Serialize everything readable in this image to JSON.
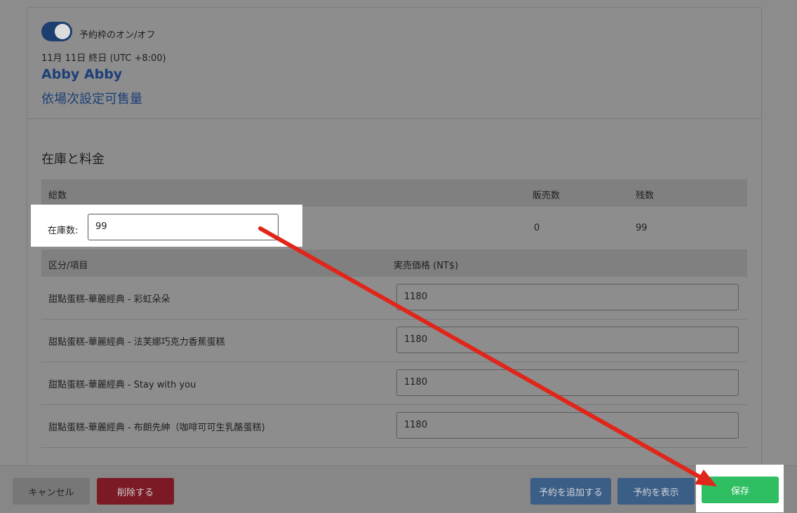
{
  "header": {
    "toggle_label": "予約枠のオン/オフ",
    "date_line": "11月 11日  終日 (UTC +8:00)",
    "guest_name": "Abby Abby",
    "link_text": "依場次設定可售量"
  },
  "inventory": {
    "section_title": "在庫と料金",
    "columns": [
      "総数",
      "販売数",
      "残数"
    ],
    "stock_label": "在庫数:",
    "stock_value": "99",
    "sold": "0",
    "remaining": "99"
  },
  "pricing": {
    "columns": [
      "区分/項目",
      "実売価格 (NT$)"
    ],
    "rows": [
      {
        "name": "甜點蛋糕-華麗經典 - 彩虹朵朵",
        "price": "1180"
      },
      {
        "name": "甜點蛋糕-華麗經典 - 法芙娜巧克力香蕉蛋糕",
        "price": "1180"
      },
      {
        "name": "甜點蛋糕-華麗經典 - Stay with you",
        "price": "1180"
      },
      {
        "name": "甜點蛋糕-華麗經典 - 布朗先紳（咖啡可可生乳酪蛋糕)",
        "price": "1180"
      }
    ]
  },
  "footer": {
    "cancel_label": "キャンセル",
    "delete_label": "削除する",
    "add_label": "予約を追加する",
    "show_label": "予約を表示",
    "save_label": "保存"
  },
  "colors": {
    "accent_blue": "#1d3f78",
    "save_green": "#2fbf62",
    "delete_red": "#7b1a24",
    "annotation_arrow": "#e0261b"
  }
}
